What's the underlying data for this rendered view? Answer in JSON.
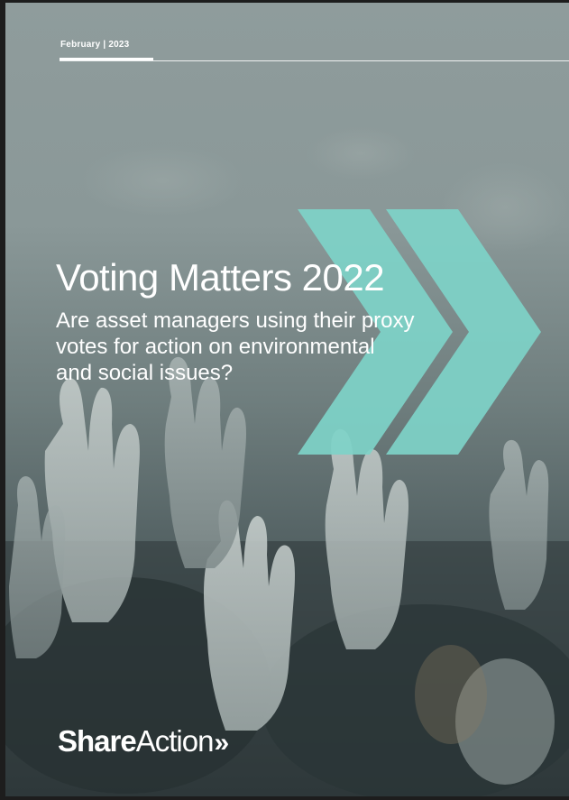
{
  "cover": {
    "date": "February | 2023",
    "title": "Voting Matters 2022",
    "subtitle_lines": [
      "Are asset managers using their proxy",
      "votes for action on environmental",
      "and social issues?"
    ],
    "logo": {
      "bold": "Share",
      "light": "Action",
      "arrows": "»"
    },
    "colors": {
      "accent": "#7ed2c8",
      "text": "#ffffff"
    },
    "background_image": "crowd-raised-hands-photo"
  }
}
